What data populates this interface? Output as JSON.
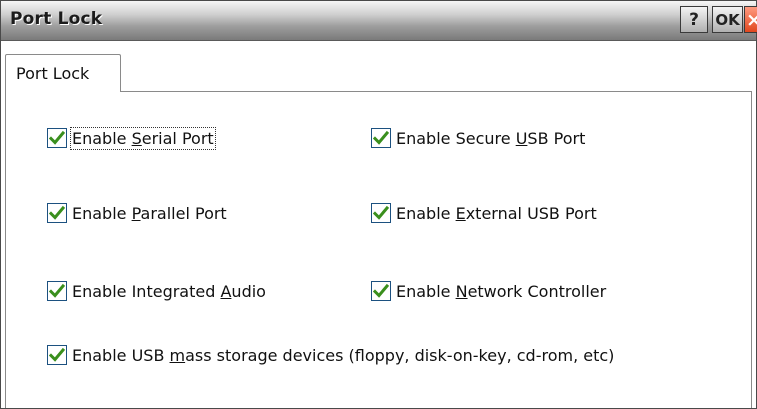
{
  "window": {
    "title": "Port Lock",
    "buttons": {
      "help": "?",
      "ok": "OK",
      "close": "×"
    }
  },
  "tabs": [
    {
      "label": "Port Lock",
      "selected": true
    }
  ],
  "options": [
    {
      "id": "serial",
      "pre": "Enable ",
      "acc": "S",
      "post": "erial Port",
      "checked": true,
      "focused": true
    },
    {
      "id": "secure-usb",
      "pre": "Enable Secure ",
      "acc": "U",
      "post": "SB Port",
      "checked": true
    },
    {
      "id": "parallel",
      "pre": "Enable ",
      "acc": "P",
      "post": "arallel Port",
      "checked": true
    },
    {
      "id": "external-usb",
      "pre": "Enable ",
      "acc": "E",
      "post": "xternal USB Port",
      "checked": true
    },
    {
      "id": "audio",
      "pre": "Enable Integrated ",
      "acc": "A",
      "post": "udio",
      "checked": true
    },
    {
      "id": "network",
      "pre": "Enable ",
      "acc": "N",
      "post": "etwork Controller",
      "checked": true
    },
    {
      "id": "usb-mass-storage",
      "pre": "Enable USB ",
      "acc": "m",
      "post": "ass storage devices (floppy, disk-on-key, cd-rom, etc)",
      "checked": true
    }
  ],
  "colors": {
    "check": "#3a8f1d",
    "checkbox_border": "#1c5180",
    "close_button": "#e1471e"
  }
}
